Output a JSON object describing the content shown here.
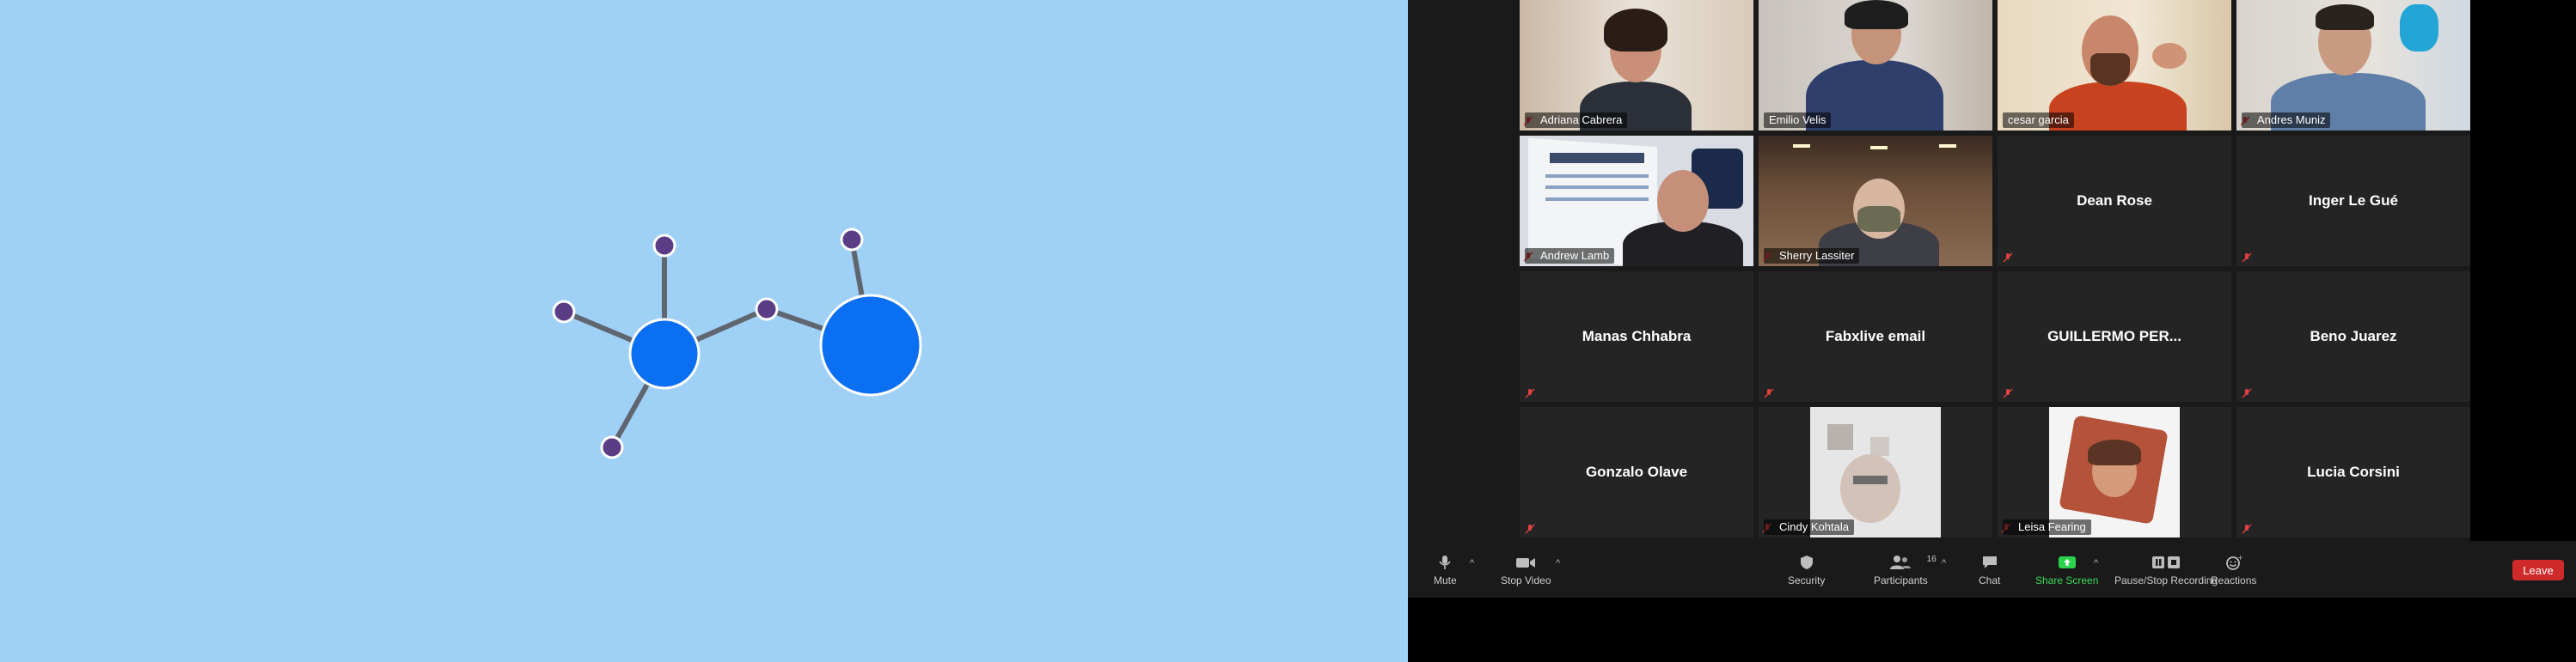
{
  "gallery": {
    "tiles": [
      {
        "name": "Adriana Cabrera",
        "type": "video"
      },
      {
        "name": "Emilio Velis",
        "type": "video"
      },
      {
        "name": "cesar garcia",
        "type": "video"
      },
      {
        "name": "Andres Muniz",
        "type": "video"
      },
      {
        "name": "Andrew Lamb",
        "type": "video"
      },
      {
        "name": "Sherry Lassiter",
        "type": "video"
      },
      {
        "name": "Dean Rose",
        "type": "name"
      },
      {
        "name": "Inger Le Gué",
        "type": "name"
      },
      {
        "name": "Manas Chhabra",
        "type": "name"
      },
      {
        "name": "Fabxlive email",
        "type": "name"
      },
      {
        "name": "GUILLERMO  PER...",
        "type": "name"
      },
      {
        "name": "Beno Juarez",
        "type": "name"
      },
      {
        "name": "Gonzalo Olave",
        "type": "name"
      },
      {
        "name": "Cindy Kohtala",
        "type": "video"
      },
      {
        "name": "Leisa Fearing",
        "type": "video"
      },
      {
        "name": "Lucia Corsini",
        "type": "name"
      }
    ]
  },
  "toolbar": {
    "mute": "Mute",
    "stop_video": "Stop Video",
    "security": "Security",
    "participants": "Participants",
    "participants_count": "16",
    "chat": "Chat",
    "share_screen": "Share Screen",
    "recording": "Pause/Stop Recording",
    "reactions": "Reactions",
    "leave": "Leave"
  },
  "colors": {
    "shared_bg": "#9fd0f6",
    "node_big": "#0a6ff0",
    "node_small": "#5b3d86",
    "share_green": "#2ad34b",
    "leave_red": "#cf2a2a",
    "active_speaker": "#b9e342"
  }
}
